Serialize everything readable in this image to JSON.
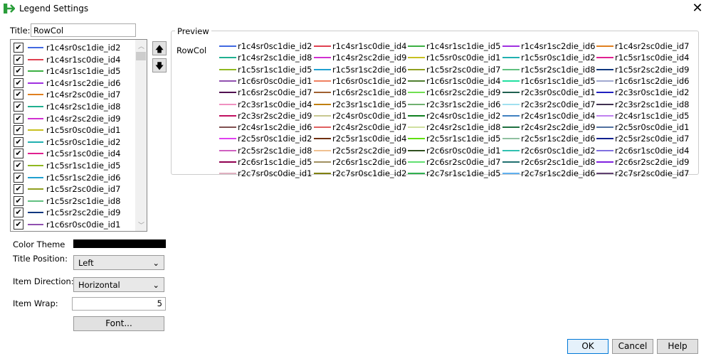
{
  "window": {
    "title": "Legend Settings",
    "close": "✕"
  },
  "title_field": {
    "label": "Title:",
    "value": "RowCol"
  },
  "buttons": {
    "up": "🡅",
    "down": "🡇",
    "font": "Font...",
    "ok": "OK",
    "cancel": "Cancel",
    "help": "Help"
  },
  "preview": {
    "label": "Preview",
    "title": "RowCol"
  },
  "settings": {
    "color_theme_label": "Color Theme",
    "color_theme_value": "#000000",
    "title_position_label": "Title Position:",
    "title_position": "Left",
    "item_direction_label": "Item Direction:",
    "item_direction": "Horizontal",
    "item_wrap_label": "Item Wrap:",
    "item_wrap": "5"
  },
  "items": [
    {
      "name": "r1c4sr0sc1die_id2",
      "color": "#4169e1"
    },
    {
      "name": "r1c4sr1sc0die_id4",
      "color": "#e04050"
    },
    {
      "name": "r1c4sr1sc1die_id5",
      "color": "#3cb043"
    },
    {
      "name": "r1c4sr1sc2die_id6",
      "color": "#a030e0"
    },
    {
      "name": "r1c4sr2sc0die_id7",
      "color": "#e08020"
    },
    {
      "name": "r1c4sr2sc1die_id8",
      "color": "#20b090"
    },
    {
      "name": "r1c4sr2sc2die_id9",
      "color": "#d030d0"
    },
    {
      "name": "r1c5sr0sc0die_id1",
      "color": "#c8c020"
    },
    {
      "name": "r1c5sr0sc1die_id2",
      "color": "#20b0b0"
    },
    {
      "name": "r1c5sr1sc0die_id4",
      "color": "#e02090"
    },
    {
      "name": "r1c5sr1sc1die_id5",
      "color": "#90b820"
    },
    {
      "name": "r1c5sr1sc2die_id6",
      "color": "#20a0d0"
    },
    {
      "name": "r1c5sr2sc0die_id7",
      "color": "#90a020"
    },
    {
      "name": "r1c5sr2sc1die_id8",
      "color": "#60c080"
    },
    {
      "name": "r1c5sr2sc2die_id9",
      "color": "#103880"
    },
    {
      "name": "r1c6sr0sc0die_id1",
      "color": "#9050b0"
    },
    {
      "name": "r1c6sr0sc1die_id2",
      "color": "#f08060"
    },
    {
      "name": "r1c6sr1sc0die_id4",
      "color": "#508030"
    },
    {
      "name": "r1c6sr1sc1die_id5",
      "color": "#20e0a0"
    },
    {
      "name": "r1c6sr1sc2die_id6",
      "color": "#a0a8d0"
    },
    {
      "name": "r1c6sr2sc0die_id7",
      "color": "#501050"
    },
    {
      "name": "r1c6sr2sc1die_id8",
      "color": "#a06030"
    },
    {
      "name": "r1c6sr2sc2die_id9",
      "color": "#70e050"
    },
    {
      "name": "r2c3sr0sc0die_id1",
      "color": "#206050"
    },
    {
      "name": "r2c3sr0sc1die_id2",
      "color": "#2020c0"
    },
    {
      "name": "r2c3sr1sc0die_id4",
      "color": "#f090c0"
    },
    {
      "name": "r2c3sr1sc1die_id5",
      "color": "#c08010"
    },
    {
      "name": "r2c3sr1sc2die_id6",
      "color": "#70b070"
    },
    {
      "name": "r2c3sr2sc0die_id7",
      "color": "#a0e0f0"
    },
    {
      "name": "r2c3sr2sc1die_id8",
      "color": "#403050"
    },
    {
      "name": "r2c3sr2sc2die_id9",
      "color": "#c01060"
    },
    {
      "name": "r2c4sr0sc0die_id1",
      "color": "#c8c890"
    },
    {
      "name": "r2c4sr0sc1die_id2",
      "color": "#108020"
    },
    {
      "name": "r2c4sr1sc0die_id4",
      "color": "#4080c0"
    },
    {
      "name": "r2c4sr1sc1die_id5",
      "color": "#c080f0"
    },
    {
      "name": "r2c4sr1sc2die_id6",
      "color": "#805050"
    },
    {
      "name": "r2c4sr2sc0die_id7",
      "color": "#e06060"
    },
    {
      "name": "r2c4sr2sc1die_id8",
      "color": "#d0e0a0"
    },
    {
      "name": "r2c4sr2sc2die_id9",
      "color": "#207040"
    },
    {
      "name": "r2c5sr0sc0die_id1",
      "color": "#5070a0"
    },
    {
      "name": "r2c5sr0sc1die_id2",
      "color": "#e040f0"
    },
    {
      "name": "r2c5sr1sc0die_id4",
      "color": "#703010"
    },
    {
      "name": "r2c5sr1sc1die_id5",
      "color": "#60e010"
    },
    {
      "name": "r2c5sr1sc2die_id6",
      "color": "#90c0a0"
    },
    {
      "name": "r2c5sr2sc0die_id7",
      "color": "#102090"
    },
    {
      "name": "r2c5sr2sc1die_id8",
      "color": "#d060c0"
    },
    {
      "name": "r2c5sr2sc2die_id9",
      "color": "#f0c090"
    },
    {
      "name": "r2c6sr0sc0die_id1",
      "color": "#305020"
    },
    {
      "name": "r2c6sr0sc1die_id2",
      "color": "#30c0b0"
    },
    {
      "name": "r2c6sr1sc0die_id4",
      "color": "#8070e0"
    },
    {
      "name": "r2c6sr1sc1die_id5",
      "color": "#900050"
    },
    {
      "name": "r2c6sr1sc2die_id6",
      "color": "#a09060"
    },
    {
      "name": "r2c6sr2sc0die_id7",
      "color": "#60e070"
    },
    {
      "name": "r2c6sr2sc1die_id8",
      "color": "#207070"
    },
    {
      "name": "r2c6sr2sc2die_id9",
      "color": "#8020e0"
    },
    {
      "name": "r2c7sr0sc0die_id1",
      "color": "#e0b0c0"
    },
    {
      "name": "r2c7sr0sc1die_id2",
      "color": "#808010"
    },
    {
      "name": "r2c7sr1sc1die_id5",
      "color": "#30b050"
    },
    {
      "name": "r2c7sr1sc2die_id6",
      "color": "#60b0f0"
    },
    {
      "name": "r2c7sr2sc0die_id7",
      "color": "#604070"
    }
  ]
}
